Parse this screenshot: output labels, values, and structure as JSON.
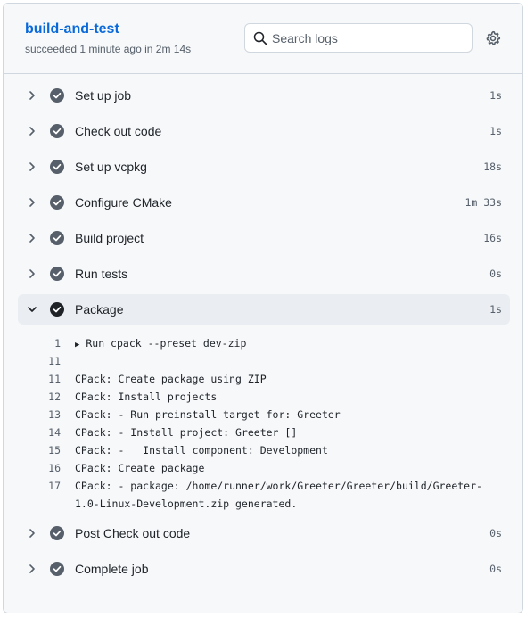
{
  "job": {
    "title": "build-and-test",
    "subtitle": "succeeded 1 minute ago in 2m 14s"
  },
  "search": {
    "placeholder": "Search logs",
    "value": ""
  },
  "icons": {
    "search": "search-icon",
    "settings": "gear-icon",
    "status": "check-circle-icon",
    "expand": "chevron-right-icon",
    "collapse": "chevron-down-icon"
  },
  "colors": {
    "link": "#0969da",
    "status_done": "#57606a",
    "status_active": "#1f2328",
    "expanded_bg": "#eaeef2"
  },
  "steps_before": [
    {
      "name": "Set up job",
      "duration": "1s"
    },
    {
      "name": "Check out code",
      "duration": "1s"
    },
    {
      "name": "Set up vcpkg",
      "duration": "18s"
    },
    {
      "name": "Configure CMake",
      "duration": "1m 33s"
    },
    {
      "name": "Build project",
      "duration": "16s"
    },
    {
      "name": "Run tests",
      "duration": "0s"
    }
  ],
  "expanded_step": {
    "name": "Package",
    "duration": "1s",
    "log": [
      {
        "num": "1",
        "text": "Run cpack --preset dev-zip",
        "group": "▶"
      },
      {
        "num": "11",
        "text": ""
      },
      {
        "num": "11",
        "text": "CPack: Create package using ZIP"
      },
      {
        "num": "12",
        "text": "CPack: Install projects"
      },
      {
        "num": "13",
        "text": "CPack: - Run preinstall target for: Greeter"
      },
      {
        "num": "14",
        "text": "CPack: - Install project: Greeter []"
      },
      {
        "num": "15",
        "text": "CPack: -   Install component: Development"
      },
      {
        "num": "16",
        "text": "CPack: Create package"
      },
      {
        "num": "17",
        "text": "CPack: - package: /home/runner/work/Greeter/Greeter/build/Greeter-1.0-Linux-Development.zip generated."
      }
    ]
  },
  "steps_after": [
    {
      "name": "Post Check out code",
      "duration": "0s"
    },
    {
      "name": "Complete job",
      "duration": "0s"
    }
  ]
}
